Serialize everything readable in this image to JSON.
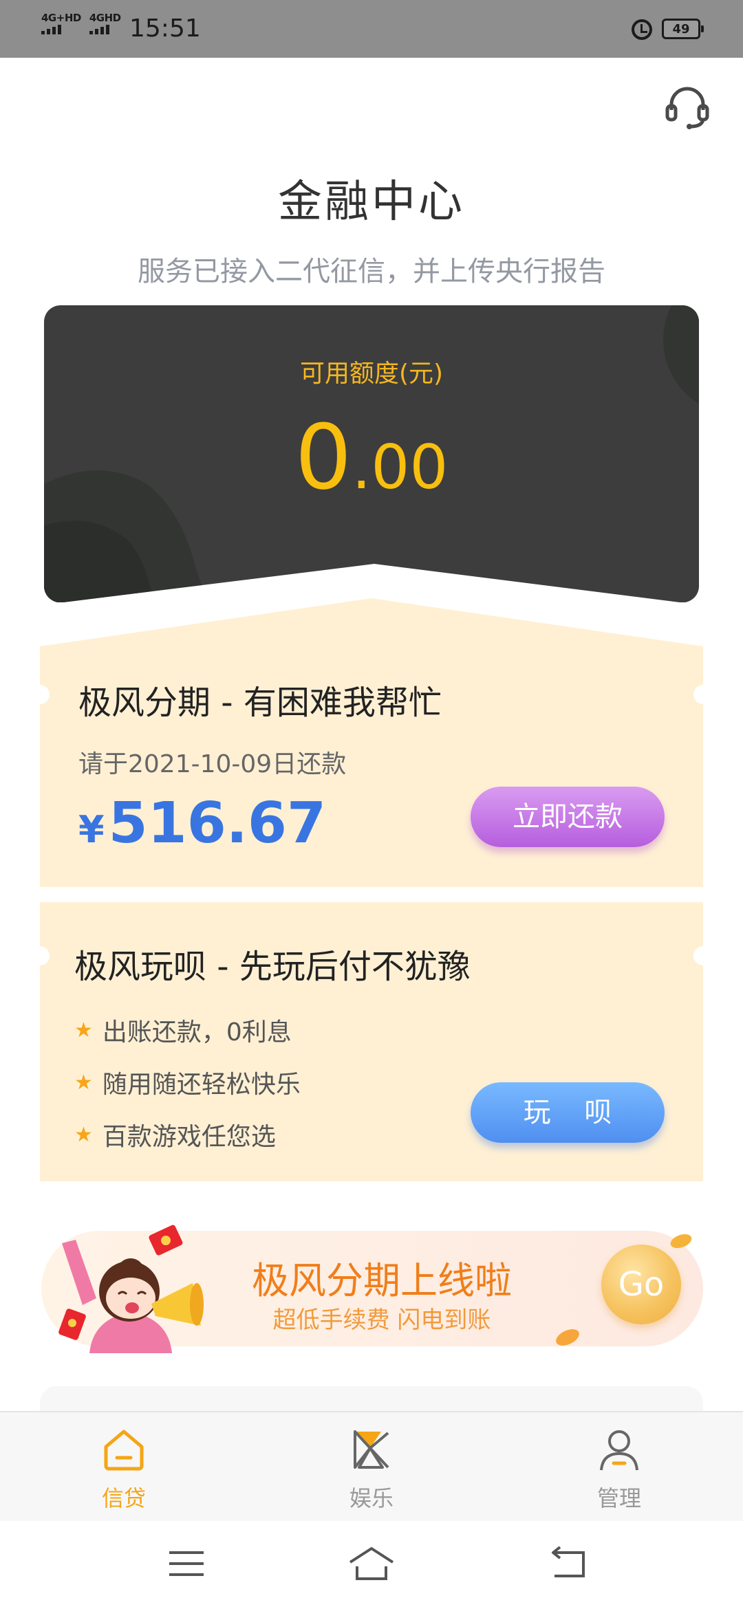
{
  "status_bar": {
    "network_1": "4G+HD",
    "network_2": "4GHD",
    "time": "15:51",
    "battery": "49"
  },
  "header": {
    "title": "金融中心",
    "subtitle": "服务已接入二代征信，并上传央行报告",
    "support_icon": "headset-icon"
  },
  "credit": {
    "label": "可用额度(元)",
    "amount_int": "0",
    "amount_dec": ".00"
  },
  "loan": {
    "title": "极风分期 - 有困难我帮忙",
    "due_text": "请于2021-10-09日还款",
    "currency": "¥",
    "amount": "516.67",
    "button_label": "立即还款"
  },
  "play": {
    "title": "极风玩呗 - 先玩后付不犹豫",
    "features": [
      "出账还款，0利息",
      "随用随还轻松快乐",
      "百款游戏任您选"
    ],
    "button_label": "玩 呗"
  },
  "promo": {
    "title": "极风分期上线啦",
    "subtitle": "超低手续费 闪电到账",
    "go_label": "Go"
  },
  "tabs": [
    {
      "label": "信贷",
      "icon": "home-icon",
      "active": true
    },
    {
      "label": "娱乐",
      "icon": "windmill-icon",
      "active": false
    },
    {
      "label": "管理",
      "icon": "user-icon",
      "active": false
    }
  ],
  "nav": {
    "icons": [
      "menu-icon",
      "home-icon",
      "back-icon"
    ]
  },
  "colors": {
    "accent_yellow": "#f5a515",
    "card_dark": "#3d3d3d",
    "card_cream": "#fff0d4",
    "amount_blue": "#3975e0",
    "repay_purple": "#c27ae6",
    "play_blue": "#5f9ff5",
    "promo_orange": "#f07e1a"
  }
}
